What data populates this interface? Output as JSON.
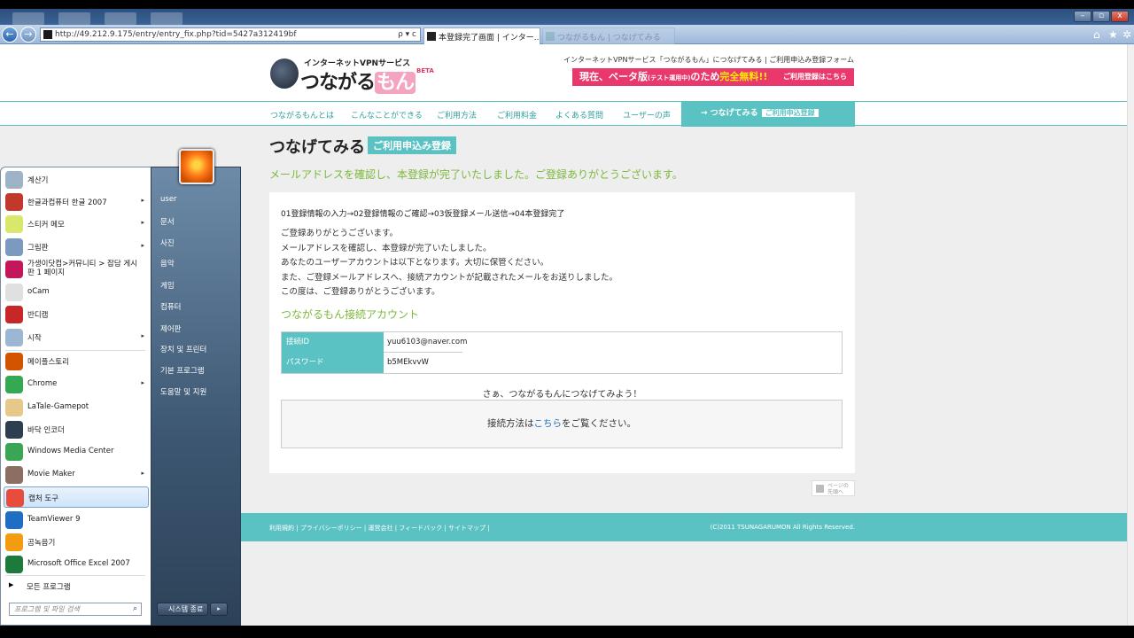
{
  "browser": {
    "address": "http://49.212.9.175/entry/entry_fix.php?tid=5427a312419bf",
    "address_right": "ρ ▾ c",
    "active_tab": "本登録完了画面 | インター...",
    "inactive_tab": "つながるもん | つなげてみる",
    "win_min": "–",
    "win_max": "▫",
    "win_close": "x",
    "back_arrow": "←",
    "fwd_arrow": "→",
    "home_icon": "home-icon",
    "star_icon": "star-icon",
    "gear_icon": "gear-icon"
  },
  "site": {
    "logo_sub": "インターネットVPNサービス",
    "logo_main_a": "つながる",
    "logo_main_b": "もん",
    "logo_beta": "BETA",
    "top_text": "インターネットVPNサービス「つながるもん」につなげてみる | ご利用申込み登録フォーム",
    "banner_a": "現在、ベータ版",
    "banner_small": "(テスト運用中)",
    "banner_b": "のため",
    "banner_free": "完全無料!!",
    "banner_cta": "ご利用登録はこちら",
    "nav": [
      "つながるもんとは",
      "こんなことができる",
      "ご利用方法",
      "ご利用料金",
      "よくある質問",
      "ユーザーの声"
    ],
    "nav_active": "→ つなげてみる",
    "nav_active_pill": "ご利用申込登録",
    "page_title": "つなげてみる",
    "page_title_pill": "ご利用申込み登録",
    "success_msg": "メールアドレスを確認し、本登録が完了いたしました。ご登録ありがとうございます。",
    "steps": "01登録情報の入力→02登録情報のご確認→03仮登録メール送信→04本登録完了",
    "body": [
      "ご登録ありがとうございます。",
      "メールアドレスを確認し、本登録が完了いたしました。",
      "あなたのユーザーアカウントは以下となります。大切に保管ください。",
      "また、ご登録メールアドレスへ、接続アカウントが記載されたメールをお送りしました。",
      "この度は、ご登録ありがとうございます。"
    ],
    "account_title": "つながるもん接続アカウント",
    "account": [
      {
        "label": "接続ID",
        "value": "yuu6103@naver.com"
      },
      {
        "label": "パスワード",
        "value": "b5MEkvvW"
      }
    ],
    "letsgo": "さぁ、つながるもんにつなげてみよう！",
    "howto_a": "接続方法は",
    "howto_link": "こちら",
    "howto_b": "をご覧ください。",
    "pagetop": "ページの先頭へ",
    "footer_links": "利用規約 | プライバシーポリシー | 運営会社 | フィードバック | サイトマップ |",
    "footer_copy": "(C)2011 TSUNAGARUMON All Rights Reserved."
  },
  "startmenu": {
    "programs": [
      {
        "label": "계산기",
        "icon": "calculator-icon",
        "color": "#9fb3c8",
        "arrow": ""
      },
      {
        "label": "한글과컴퓨터 한글 2007",
        "icon": "hangul-icon",
        "color": "#c0392b",
        "arrow": "▸"
      },
      {
        "label": "스티커 메모",
        "icon": "sticky-note-icon",
        "color": "#d9e86a",
        "arrow": "▸"
      },
      {
        "label": "그림판",
        "icon": "paint-icon",
        "color": "#7a9bbf",
        "arrow": "▸"
      },
      {
        "label": "가생이닷컴>커뮤니티 > 잡담 게시판 1 페이지",
        "icon": "web-shortcut-icon",
        "color": "#c2185b",
        "arrow": ""
      },
      {
        "label": "oCam",
        "icon": "ocam-icon",
        "color": "#e0e0e0",
        "arrow": ""
      },
      {
        "label": "반디캠",
        "icon": "bandicam-icon",
        "color": "#c62828",
        "arrow": ""
      },
      {
        "label": "시작",
        "icon": "start-doc-icon",
        "color": "#9cb7d4",
        "arrow": "▸"
      },
      {
        "label": "메이플스토리",
        "icon": "maplestory-icon",
        "color": "#d35400",
        "arrow": ""
      },
      {
        "label": "Chrome",
        "icon": "chrome-icon",
        "color": "#34a853",
        "arrow": "▸"
      },
      {
        "label": "LaTale-Gamepot",
        "icon": "latale-icon",
        "color": "#e6c98a",
        "arrow": ""
      },
      {
        "label": "바닥 인코더",
        "icon": "encoder-icon",
        "color": "#2c3e50",
        "arrow": ""
      },
      {
        "label": "Windows Media Center",
        "icon": "media-center-icon",
        "color": "#3aa655",
        "arrow": ""
      },
      {
        "label": "Movie Maker",
        "icon": "movie-maker-icon",
        "color": "#8d6e63",
        "arrow": "▸"
      },
      {
        "label": "캡처 도구",
        "icon": "snipping-tool-icon",
        "color": "#e74c3c",
        "arrow": ""
      },
      {
        "label": "TeamViewer 9",
        "icon": "teamviewer-icon",
        "color": "#1e6fc4",
        "arrow": ""
      },
      {
        "label": "곰녹음기",
        "icon": "gom-recorder-icon",
        "color": "#f39c12",
        "arrow": ""
      },
      {
        "label": "Microsoft Office Excel 2007",
        "icon": "excel-icon",
        "color": "#1e7a3c",
        "arrow": ""
      }
    ],
    "all_programs": "모든 프로그램",
    "search_placeholder": "프로그램 및 파일 검색",
    "right_items": [
      "user",
      "문서",
      "사진",
      "음악",
      "게임",
      "컴퓨터",
      "제어판",
      "장치 및 프린터",
      "기본 프로그램",
      "도움말 및 지원"
    ],
    "shutdown": "시스템 종료"
  }
}
